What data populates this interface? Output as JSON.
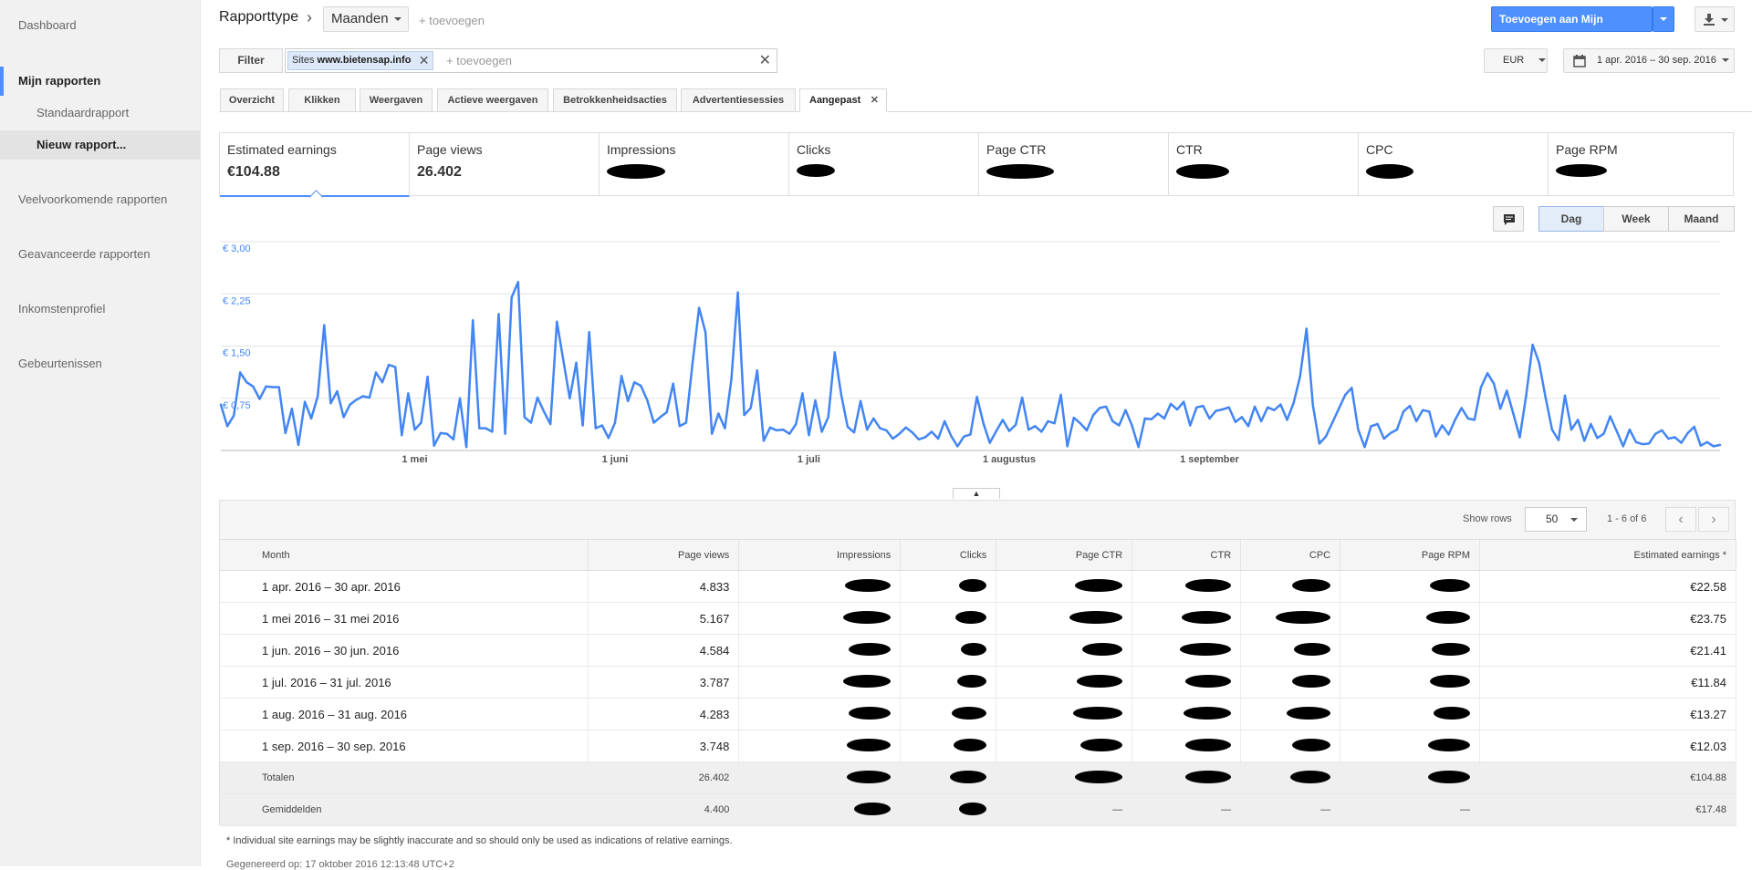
{
  "sidebar": {
    "items": [
      {
        "label": "Dashboard"
      },
      {
        "label": "Mijn rapporten"
      },
      {
        "label": "Standaardrapport"
      },
      {
        "label": "Nieuw rapport..."
      },
      {
        "label": "Veelvoorkomende rapporten"
      },
      {
        "label": "Geavanceerde rapporten"
      },
      {
        "label": "Inkomstenprofiel"
      },
      {
        "label": "Gebeurtenissen"
      }
    ]
  },
  "header": {
    "report_type": "Rapporttype",
    "dimension": "Maanden",
    "add_dimension": "+ toevoegen",
    "add_to_reports": "Toevoegen aan Mijn rapporten"
  },
  "filter": {
    "label": "Filter",
    "chip_prefix": "Sites",
    "chip_value": "www.bietensap.info",
    "placeholder": "+ toevoegen"
  },
  "currency": "EUR",
  "date_range": "1 apr. 2016 – 30 sep. 2016",
  "tabs": [
    {
      "label": "Overzicht"
    },
    {
      "label": "Klikken"
    },
    {
      "label": "Weergaven"
    },
    {
      "label": "Actieve weergaven"
    },
    {
      "label": "Betrokkenheidsacties"
    },
    {
      "label": "Advertentiesessies"
    },
    {
      "label": "Aangepast"
    }
  ],
  "metrics": [
    {
      "label": "Estimated earnings",
      "value": "€104.88"
    },
    {
      "label": "Page views",
      "value": "26.402"
    },
    {
      "label": "Impressions",
      "value": ""
    },
    {
      "label": "Clicks",
      "value": ""
    },
    {
      "label": "Page CTR",
      "value": ""
    },
    {
      "label": "CTR",
      "value": ""
    },
    {
      "label": "CPC",
      "value": ""
    },
    {
      "label": "Page RPM",
      "value": ""
    }
  ],
  "view_toggle": {
    "day": "Dag",
    "week": "Week",
    "month": "Maand",
    "active": "day"
  },
  "chart_data": {
    "type": "line",
    "series": [
      {
        "color": "#4285f4",
        "values": [
          0.66,
          0.35,
          0.5,
          1.12,
          0.98,
          0.92,
          0.74,
          0.92,
          0.91,
          0.91,
          0.25,
          0.6,
          0.08,
          0.7,
          0.46,
          0.78,
          1.8,
          0.68,
          0.85,
          0.48,
          0.66,
          0.73,
          0.78,
          0.76,
          1.12,
          0.98,
          1.23,
          1.2,
          0.22,
          0.82,
          0.3,
          0.4,
          1.06,
          0.07,
          0.25,
          0.24,
          0.16,
          0.75,
          0.05,
          1.87,
          0.32,
          0.32,
          0.27,
          1.96,
          0.24,
          2.2,
          2.42,
          0.48,
          0.4,
          0.76,
          0.56,
          0.38,
          1.85,
          1.3,
          0.75,
          1.26,
          0.36,
          1.7,
          0.32,
          0.36,
          0.18,
          0.4,
          1.07,
          0.71,
          0.98,
          0.93,
          0.72,
          0.4,
          0.48,
          0.55,
          0.96,
          0.35,
          0.4,
          1.26,
          2.05,
          1.7,
          0.24,
          0.53,
          0.32,
          1.02,
          2.27,
          0.51,
          0.61,
          1.15,
          0.14,
          0.33,
          0.29,
          0.3,
          0.24,
          0.38,
          0.82,
          0.22,
          0.72,
          0.27,
          0.48,
          1.41,
          0.8,
          0.34,
          0.26,
          0.71,
          0.3,
          0.46,
          0.32,
          0.29,
          0.17,
          0.24,
          0.33,
          0.26,
          0.16,
          0.19,
          0.27,
          0.17,
          0.42,
          0.21,
          0.06,
          0.2,
          0.23,
          0.77,
          0.39,
          0.11,
          0.28,
          0.44,
          0.28,
          0.37,
          0.76,
          0.3,
          0.35,
          0.27,
          0.42,
          0.39,
          0.8,
          0.06,
          0.47,
          0.39,
          0.29,
          0.51,
          0.61,
          0.63,
          0.42,
          0.36,
          0.58,
          0.36,
          0.05,
          0.46,
          0.45,
          0.53,
          0.46,
          0.67,
          0.59,
          0.7,
          0.36,
          0.62,
          0.64,
          0.46,
          0.57,
          0.59,
          0.62,
          0.41,
          0.48,
          0.35,
          0.63,
          0.42,
          0.62,
          0.58,
          0.66,
          0.44,
          0.68,
          1.06,
          1.75,
          0.65,
          0.1,
          0.2,
          0.4,
          0.6,
          0.8,
          0.9,
          0.3,
          0.05,
          0.35,
          0.38,
          0.17,
          0.25,
          0.3,
          0.56,
          0.64,
          0.42,
          0.58,
          0.56,
          0.2,
          0.36,
          0.23,
          0.44,
          0.61,
          0.46,
          0.44,
          0.91,
          1.11,
          0.96,
          0.6,
          0.86,
          0.53,
          0.19,
          0.79,
          1.52,
          1.26,
          0.76,
          0.3,
          0.15,
          0.79,
          0.3,
          0.44,
          0.14,
          0.38,
          0.18,
          0.24,
          0.49,
          0.28,
          0.06,
          0.3,
          0.12,
          0.09,
          0.1,
          0.24,
          0.29,
          0.17,
          0.19,
          0.11,
          0.25,
          0.34,
          0.07,
          0.12,
          0.06,
          0.08
        ]
      }
    ],
    "y_ticks": [
      "€ 3,00",
      "€ 2,25",
      "€ 1,50",
      "€ 0,75"
    ],
    "ylim": [
      0,
      3
    ],
    "x_ticks": [
      "1 mei",
      "1 juni",
      "1 juli",
      "1 augustus",
      "1 september"
    ],
    "x_tick_days": [
      30,
      61,
      91,
      122,
      153
    ],
    "grid": true
  },
  "table": {
    "show_rows_label": "Show rows",
    "rows_value": "50",
    "pager": "1 - 6 of 6",
    "headers": [
      "Month",
      "Page views",
      "Impressions",
      "Clicks",
      "Page CTR",
      "CTR",
      "CPC",
      "Page RPM",
      "Estimated earnings *"
    ],
    "rows": [
      {
        "month": "1 apr. 2016 – 30 apr. 2016",
        "page_views": "4.833",
        "earnings": "€22.58"
      },
      {
        "month": "1 mei 2016 – 31 mei 2016",
        "page_views": "5.167",
        "earnings": "€23.75"
      },
      {
        "month": "1 jun. 2016 – 30 jun. 2016",
        "page_views": "4.584",
        "earnings": "€21.41"
      },
      {
        "month": "1 jul. 2016 – 31 jul. 2016",
        "page_views": "3.787",
        "earnings": "€11.84"
      },
      {
        "month": "1 aug. 2016 – 31 aug. 2016",
        "page_views": "4.283",
        "earnings": "€13.27"
      },
      {
        "month": "1 sep. 2016 – 30 sep. 2016",
        "page_views": "3.748",
        "earnings": "€12.03"
      }
    ],
    "totals": {
      "label": "Totalen",
      "page_views": "26.402",
      "earnings": "€104.88"
    },
    "averages": {
      "label": "Gemiddelden",
      "page_views": "4.400",
      "page_ctr": "—",
      "ctr": "—",
      "cpc": "—",
      "page_rpm": "—",
      "earnings": "€17.48"
    }
  },
  "footnote": "* Individual site earnings may be slightly inaccurate and so should only be used as indications of relative earnings.",
  "generated": "Gegenereerd op: 17 oktober 2016 12:13:48 UTC+2",
  "colors": {
    "accent": "#4d90fe",
    "line": "#4285f4"
  }
}
